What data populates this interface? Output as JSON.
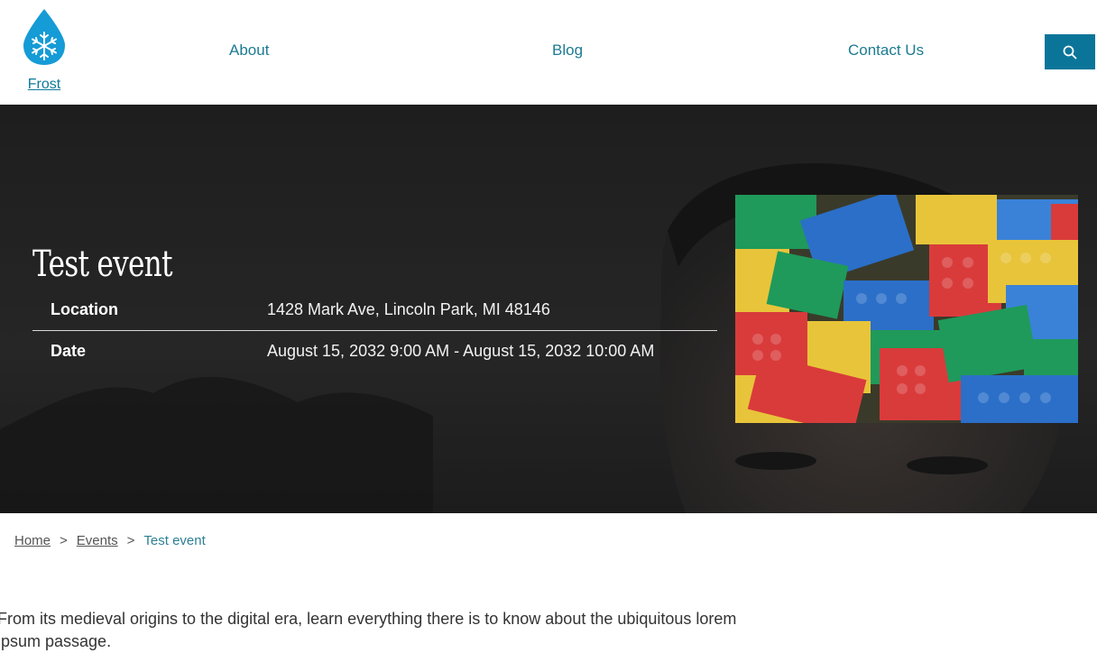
{
  "header": {
    "brand_name": "Frost",
    "logo_icon": "snowflake-drop-icon",
    "nav": [
      {
        "label": "About"
      },
      {
        "label": "Blog"
      },
      {
        "label": "Contact Us"
      }
    ],
    "search_icon": "search-icon"
  },
  "event": {
    "title": "Test event",
    "location_label": "Location",
    "location_value": "1428 Mark Ave, Lincoln Park, MI 48146",
    "date_label": "Date",
    "date_value": "August 15, 2032 9:00 AM - August 15, 2032 10:00 AM",
    "image": "lego-bricks-photo"
  },
  "breadcrumb": {
    "home": "Home",
    "separator": ">",
    "events": "Events",
    "current": "Test event"
  },
  "body": {
    "lede": "From its medieval origins to the digital era, learn everything there is to know about the ubiquitous lorem ipsum passage."
  },
  "colors": {
    "accent": "#0b7599",
    "nav_text": "#1c7b91",
    "hero_overlay": "#1f1f1f"
  }
}
